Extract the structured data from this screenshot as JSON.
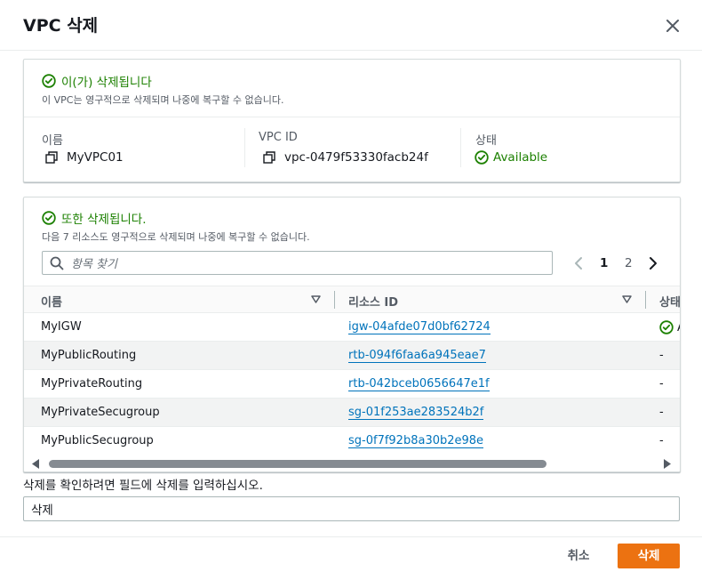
{
  "modal": {
    "title": "VPC 삭제",
    "cancel_label": "취소",
    "delete_label": "삭제"
  },
  "vpc_panel": {
    "heading": "이(가) 삭제됩니다",
    "subtext": "이 VPC는 영구적으로 삭제되며 나중에 복구할 수 없습니다.",
    "name_label": "이름",
    "name_value": "MyVPC01",
    "id_label": "VPC ID",
    "id_value": "vpc-0479f53330facb24f",
    "state_label": "상태",
    "state_value": "Available"
  },
  "resources_panel": {
    "heading": "또한 삭제됩니다.",
    "subtext": "다음 7 리소스도 영구적으로 삭제되며 나중에 복구할 수 없습니다.",
    "search_placeholder": "항목 찾기",
    "pages": [
      "1",
      "2"
    ],
    "current_page": "1",
    "columns": [
      "이름",
      "리소스 ID",
      "상태"
    ],
    "rows": [
      {
        "name": "MyIGW",
        "id": "igw-04afde07d0bf62724",
        "status": "A"
      },
      {
        "name": "MyPublicRouting",
        "id": "rtb-094f6faa6a945eae7",
        "status": "-"
      },
      {
        "name": "MyPrivateRouting",
        "id": "rtb-042bceb0656647e1f",
        "status": "-"
      },
      {
        "name": "MyPrivateSecugroup",
        "id": "sg-01f253ae283524b2f",
        "status": "-"
      },
      {
        "name": "MyPublicSecugroup",
        "id": "sg-0f7f92b8a30b2e98e",
        "status": "-"
      }
    ]
  },
  "confirm": {
    "label": "삭제를 확인하려면 필드에 삭제를 입력하십시오.",
    "value": "삭제"
  },
  "colors": {
    "accent": "#ec7211",
    "success": "#1d8102",
    "link": "#0073bb"
  }
}
